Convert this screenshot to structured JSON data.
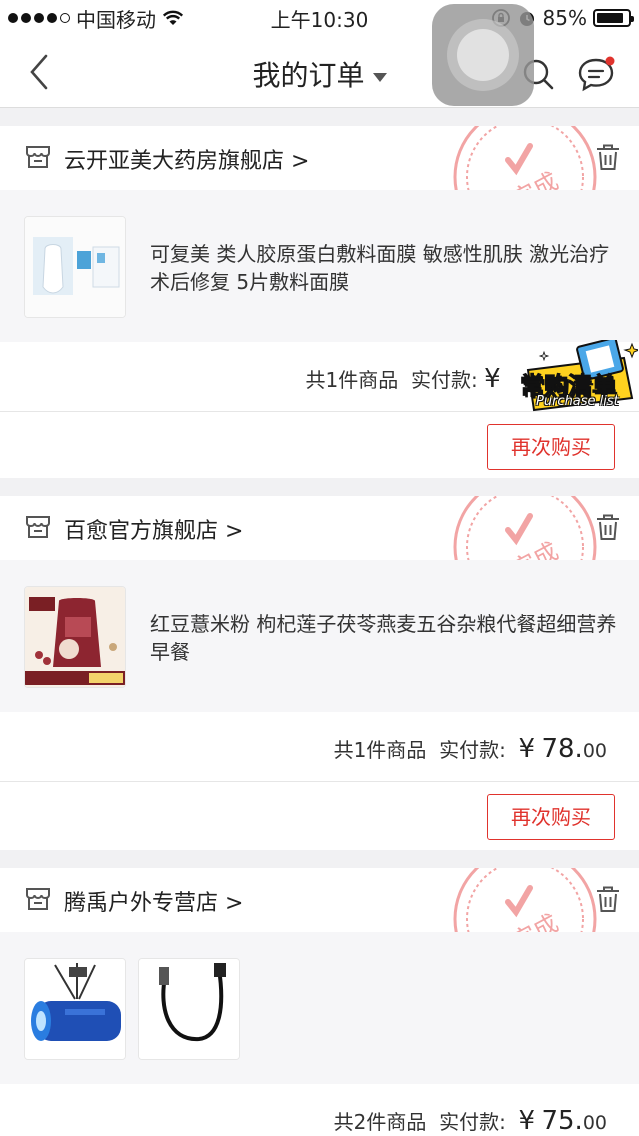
{
  "status_bar": {
    "carrier": "中国移动",
    "time": "上午10:30",
    "battery": "85%",
    "battery_level": 0.85
  },
  "nav": {
    "title": "我的订单",
    "back_icon": "chevron-left-icon",
    "search_icon": "search-icon",
    "message_icon": "chat-icon"
  },
  "orders": [
    {
      "shop": "云开亚美大药房旗舰店 >",
      "status": "已完成",
      "product_title": "可复美 类人胶原蛋白敷料面膜 敏感性肌肤 激光治疗术后修复 5片敷料面膜",
      "count_label": "共1件商品",
      "paid_label": "实付款:",
      "price_symbol": "¥",
      "price_int": "",
      "price_cents": "",
      "rebuy_label": "再次购买"
    },
    {
      "shop": "百愈官方旗舰店 >",
      "status": "已完成",
      "product_title": "红豆薏米粉 枸杞莲子茯苓燕麦五谷杂粮代餐超细营养早餐",
      "count_label": "共1件商品",
      "paid_label": "实付款:",
      "price_symbol": "¥",
      "price_int": "78.",
      "price_cents": "00",
      "rebuy_label": "再次购买"
    },
    {
      "shop": "腾禹户外专营店 >",
      "status": "已完成",
      "product_title": "",
      "count_label": "共2件商品",
      "paid_label": "实付款:",
      "price_symbol": "¥",
      "price_int": "75.",
      "price_cents": "00",
      "rebuy_label": ""
    }
  ],
  "promo_badge": {
    "cn": "常购清单",
    "en": "Purchase list"
  },
  "colors": {
    "accent_red": "#e0332d",
    "stamp_red": "#f2a4a4"
  }
}
